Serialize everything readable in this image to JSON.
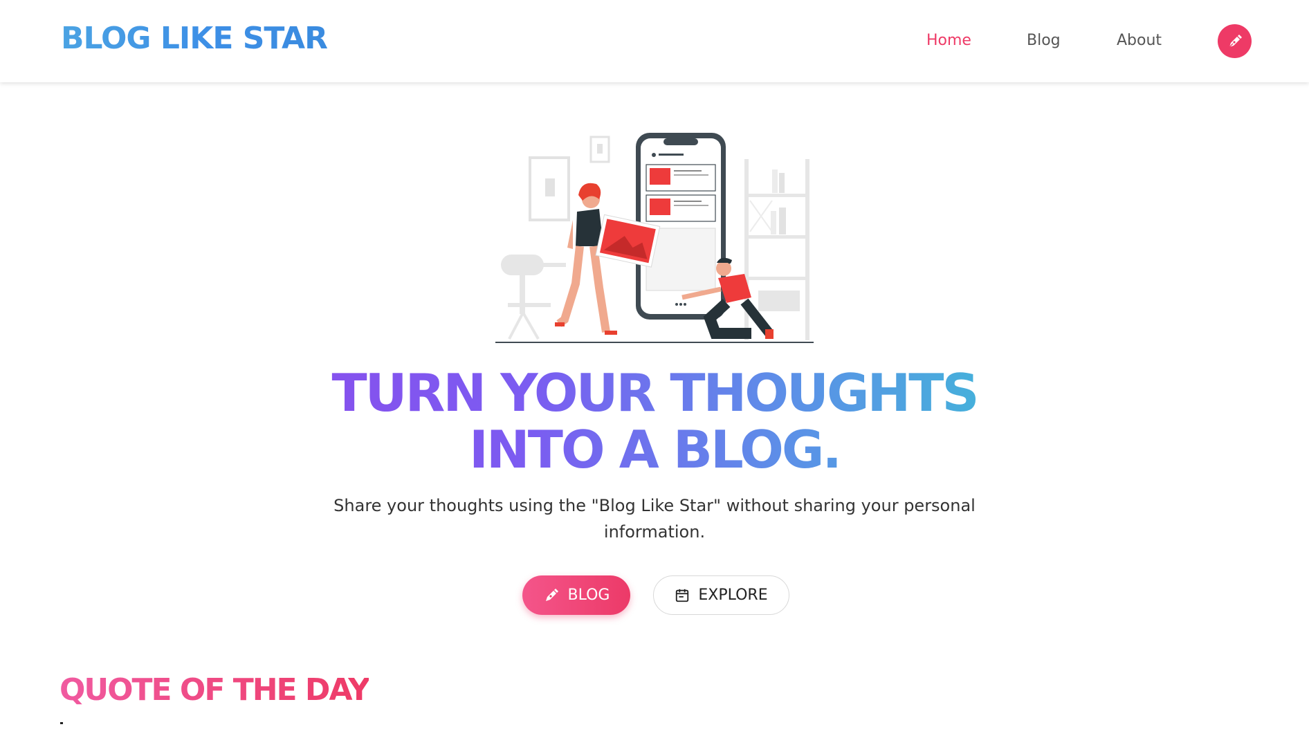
{
  "brand": {
    "name": "BLOG LIKE STAR"
  },
  "nav": {
    "items": [
      {
        "label": "Home",
        "active": true
      },
      {
        "label": "Blog",
        "active": false
      },
      {
        "label": "About",
        "active": false
      }
    ],
    "action_icon": "pen-icon",
    "accent": "#ee3a66"
  },
  "hero": {
    "title_line1": "TURN YOUR THOUGHTS",
    "title_line2": "INTO A BLOG.",
    "subtitle": "Share your thoughts using the \"Blog Like Star\" without sharing your personal information.",
    "primary_button": {
      "label": "BLOG",
      "icon": "pen-icon"
    },
    "secondary_button": {
      "label": "EXPLORE",
      "icon": "calendar-icon"
    }
  },
  "quote": {
    "heading": "QUOTE OF THE DAY"
  }
}
